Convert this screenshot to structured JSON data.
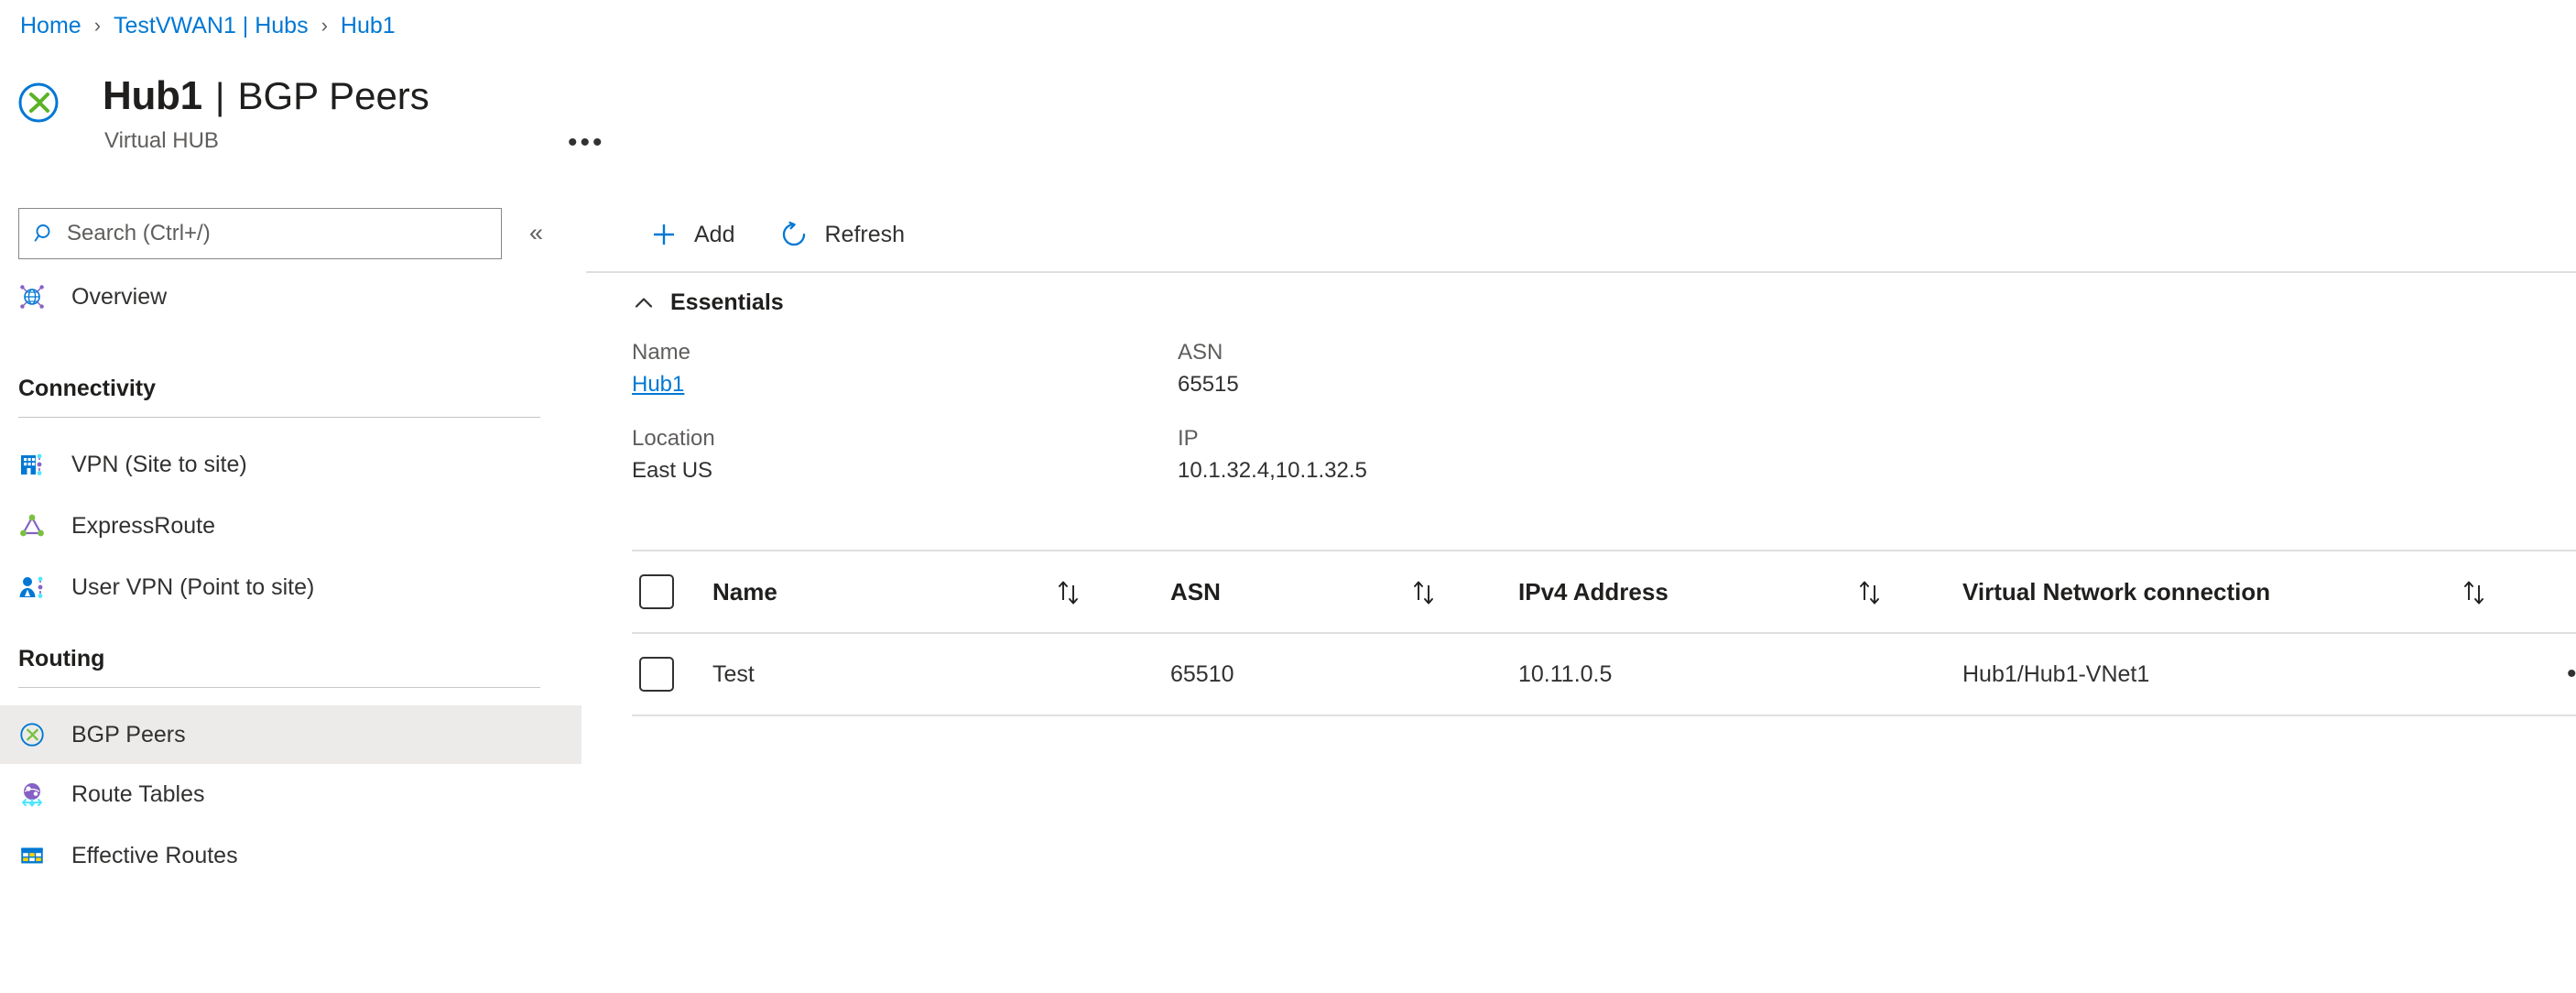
{
  "breadcrumb": {
    "items": [
      {
        "label": "Home"
      },
      {
        "label": "TestVWAN1 | Hubs"
      },
      {
        "label": "Hub1"
      }
    ],
    "separator": "›"
  },
  "header": {
    "resource_name": "Hub1",
    "separator": "|",
    "page_name": "BGP Peers",
    "subtitle": "Virtual HUB",
    "more_label": "•••",
    "icon": "virtual-hub-icon"
  },
  "sidebar": {
    "search": {
      "placeholder": "Search (Ctrl+/)",
      "value": "",
      "icon": "search-icon"
    },
    "collapse_label": "«",
    "top_items": [
      {
        "label": "Overview",
        "icon": "overview-globe-icon",
        "selected": false
      }
    ],
    "sections": [
      {
        "title": "Connectivity",
        "items": [
          {
            "label": "VPN (Site to site)",
            "icon": "vpn-site-to-site-icon",
            "selected": false
          },
          {
            "label": "ExpressRoute",
            "icon": "expressroute-icon",
            "selected": false
          },
          {
            "label": "User VPN (Point to site)",
            "icon": "user-vpn-point-to-site-icon",
            "selected": false
          }
        ]
      },
      {
        "title": "Routing",
        "items": [
          {
            "label": "BGP Peers",
            "icon": "bgp-peers-icon",
            "selected": true
          },
          {
            "label": "Route Tables",
            "icon": "route-tables-icon",
            "selected": false
          },
          {
            "label": "Effective Routes",
            "icon": "effective-routes-icon",
            "selected": false
          }
        ]
      }
    ]
  },
  "toolbar": {
    "add_label": "Add",
    "add_icon": "plus-icon",
    "refresh_label": "Refresh",
    "refresh_icon": "refresh-icon"
  },
  "essentials": {
    "title": "Essentials",
    "chevron_icon": "chevron-up-icon",
    "expanded": true,
    "left_fields": [
      {
        "key": "Name",
        "value": "Hub1",
        "is_link": true
      },
      {
        "key": "Location",
        "value": "East US",
        "is_link": false
      }
    ],
    "right_fields": [
      {
        "key": "ASN",
        "value": "65515",
        "is_link": false
      },
      {
        "key": "IP",
        "value": "10.1.32.4,10.1.32.5",
        "is_link": false
      }
    ]
  },
  "table": {
    "select_all_checked": false,
    "columns": [
      {
        "label": "Name",
        "sortable": true
      },
      {
        "label": "ASN",
        "sortable": true
      },
      {
        "label": "IPv4 Address",
        "sortable": true
      },
      {
        "label": "Virtual Network connection",
        "sortable": true
      }
    ],
    "sort_icon": "sort-updown-icon",
    "row_menu_label": "•••",
    "rows": [
      {
        "checked": false,
        "name": "Test",
        "asn": "65510",
        "ipv4": "10.11.0.5",
        "vnet": "Hub1/Hub1-VNet1"
      }
    ]
  },
  "colors": {
    "accent": "#0078d4",
    "link": "#0078d4",
    "text": "#323130",
    "muted": "#605e5c",
    "selected_bg": "#edebe9",
    "rule": "#e1dfdd",
    "green": "#5bb226",
    "purple": "#8661c5"
  }
}
